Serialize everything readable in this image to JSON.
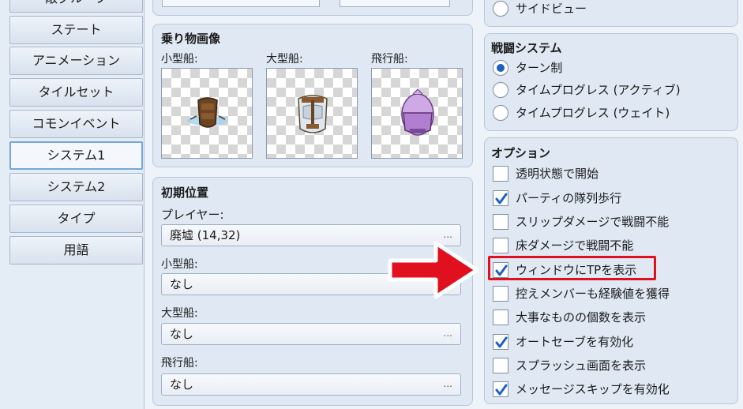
{
  "sidebar": {
    "items": [
      {
        "label": "敵グループ"
      },
      {
        "label": "ステート"
      },
      {
        "label": "アニメーション"
      },
      {
        "label": "タイルセット"
      },
      {
        "label": "コモンイベント"
      },
      {
        "label": "システム1"
      },
      {
        "label": "システム2"
      },
      {
        "label": "タイプ"
      },
      {
        "label": "用語"
      }
    ],
    "active": "システム1"
  },
  "vehicles": {
    "title": "乗り物画像",
    "boat_label": "小型船:",
    "ship_label": "大型船:",
    "airship_label": "飛行船:"
  },
  "start_position": {
    "title": "初期位置",
    "player_label": "プレイヤー:",
    "player_value": "廃墟 (14,32)",
    "boat_label": "小型船:",
    "boat_value": "なし",
    "ship_label": "大型船:",
    "ship_value": "なし",
    "airship_label": "飛行船:",
    "airship_value": "なし",
    "ellipsis": "..."
  },
  "top_right_partial": {
    "sideview_label": "サイドビュー"
  },
  "battle_system": {
    "title": "戦闘システム",
    "options": [
      {
        "label": "ターン制",
        "selected": true
      },
      {
        "label": "タイムプログレス (アクティブ)",
        "selected": false
      },
      {
        "label": "タイムプログレス (ウェイト)",
        "selected": false
      }
    ]
  },
  "options": {
    "title": "オプション",
    "items": [
      {
        "label": "透明状態で開始",
        "checked": false
      },
      {
        "label": "パーティの隊列歩行",
        "checked": true
      },
      {
        "label": "スリップダメージで戦闘不能",
        "checked": false
      },
      {
        "label": "床ダメージで戦闘不能",
        "checked": false
      },
      {
        "label": "ウィンドウにTPを表示",
        "checked": true
      },
      {
        "label": "控えメンバーも経験値を獲得",
        "checked": false
      },
      {
        "label": "大事なものの個数を表示",
        "checked": false
      },
      {
        "label": "オートセーブを有効化",
        "checked": true
      },
      {
        "label": "スプラッシュ画面を表示",
        "checked": false
      },
      {
        "label": "メッセージスキップを有効化",
        "checked": true
      }
    ]
  },
  "colors": {
    "arrow": "#e0101f",
    "highlight": "#e0101f",
    "accent": "#1f5fbf",
    "check": "#1f5fbf"
  },
  "icons": {
    "arrow": "right-arrow-icon",
    "check": "check-icon"
  }
}
